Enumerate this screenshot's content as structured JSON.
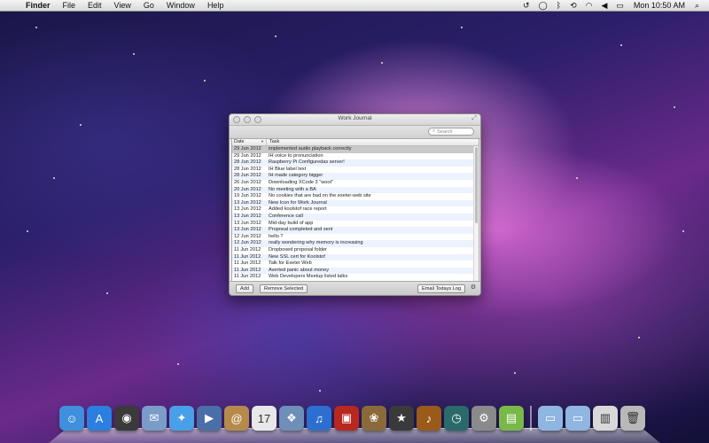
{
  "menubar": {
    "apple_glyph": "",
    "app": "Finder",
    "menus": [
      "File",
      "Edit",
      "View",
      "Go",
      "Window",
      "Help"
    ],
    "clock": "Mon 10:50 AM",
    "status_icons": [
      "time-machine-icon",
      "messages-icon",
      "bluetooth-icon",
      "sync-icon",
      "wifi-icon",
      "volume-icon",
      "battery-icon"
    ],
    "search_glyph": "⌕"
  },
  "window": {
    "title": "Work Journal",
    "search_placeholder": "Search",
    "columns": {
      "date": "Date",
      "task": "Task"
    },
    "rows": [
      {
        "date": "29 Jun 2012",
        "task": "implemented audio playback correctly",
        "selected": true
      },
      {
        "date": "29 Jun 2012",
        "task": "IH voice to pronunciation"
      },
      {
        "date": "28 Jun 2012",
        "task": "Raspberry Pi Configuredas server!"
      },
      {
        "date": "28 Jun 2012",
        "task": "IH Blue label text"
      },
      {
        "date": "28 Jun 2012",
        "task": "IH made category bigger"
      },
      {
        "date": "26 Jun 2012",
        "task": "Downloading XCode 3 \"woot\""
      },
      {
        "date": "20 Jun 2012",
        "task": "No meeting with a BA"
      },
      {
        "date": "19 Jun 2012",
        "task": "No cookies that are bad on the exeter-web site"
      },
      {
        "date": "13 Jun 2012",
        "task": "New Icon for Work Journal"
      },
      {
        "date": "13 Jun 2012",
        "task": "Added koolstof race report"
      },
      {
        "date": "13 Jun 2012",
        "task": "Conference call"
      },
      {
        "date": "13 Jun 2012",
        "task": "Mid-day build of app"
      },
      {
        "date": "13 Jun 2012",
        "task": "Proposal completed and sent"
      },
      {
        "date": "12 Jun 2012",
        "task": "hello ?"
      },
      {
        "date": "12 Jun 2012",
        "task": "really wondering why memory is increasing"
      },
      {
        "date": "11 Jun 2012",
        "task": "Dropboxed proposal folder"
      },
      {
        "date": "11 Jun 2012",
        "task": "New SSL cert for Koolstof"
      },
      {
        "date": "11 Jun 2012",
        "task": "Talk for Exeter Web"
      },
      {
        "date": "11 Jun 2012",
        "task": "Averted panic about money"
      },
      {
        "date": "11 Jun 2012",
        "task": "Web Developers Meetup listed talks"
      }
    ],
    "buttons": {
      "add": "Add",
      "remove": "Remove Selected",
      "email": "Email Todays Log"
    }
  },
  "dock": {
    "apps": [
      {
        "name": "finder-icon",
        "color": "#3f8fdc",
        "glyph": "☺"
      },
      {
        "name": "app-store-icon",
        "color": "#2b7fe0",
        "glyph": "A"
      },
      {
        "name": "dashboard-icon",
        "color": "#3a3a3a",
        "glyph": "◉"
      },
      {
        "name": "mail-icon",
        "color": "#7b9cc9",
        "glyph": "✉"
      },
      {
        "name": "safari-icon",
        "color": "#4aa0e8",
        "glyph": "✦"
      },
      {
        "name": "facetime-icon",
        "color": "#4a6fa8",
        "glyph": "▶"
      },
      {
        "name": "address-book-icon",
        "color": "#b58a4a",
        "glyph": "@"
      },
      {
        "name": "ical-icon",
        "color": "#e8e8e8",
        "glyph": "17"
      },
      {
        "name": "preview-icon",
        "color": "#6d8fb8",
        "glyph": "❖"
      },
      {
        "name": "itunes-icon",
        "color": "#2d6fd0",
        "glyph": "♫"
      },
      {
        "name": "photo-booth-icon",
        "color": "#b8281e",
        "glyph": "▣"
      },
      {
        "name": "iphoto-icon",
        "color": "#8a6a3a",
        "glyph": "❀"
      },
      {
        "name": "imovie-icon",
        "color": "#3a3a3a",
        "glyph": "★"
      },
      {
        "name": "garageband-icon",
        "color": "#9a5a1a",
        "glyph": "♪"
      },
      {
        "name": "time-machine-icon",
        "color": "#2a6a6a",
        "glyph": "◷"
      },
      {
        "name": "system-preferences-icon",
        "color": "#8a8a8a",
        "glyph": "⚙"
      },
      {
        "name": "work-journal-icon",
        "color": "#7ab84a",
        "glyph": "▤"
      }
    ],
    "right": [
      {
        "name": "applications-folder-icon",
        "color": "#8fb6e0",
        "glyph": "▭"
      },
      {
        "name": "documents-folder-icon",
        "color": "#8fb6e0",
        "glyph": "▭"
      },
      {
        "name": "downloads-stack-icon",
        "color": "#d8d8d8",
        "glyph": "▥"
      },
      {
        "name": "trash-icon",
        "color": "#b8b8b8",
        "glyph": "🗑"
      }
    ]
  }
}
